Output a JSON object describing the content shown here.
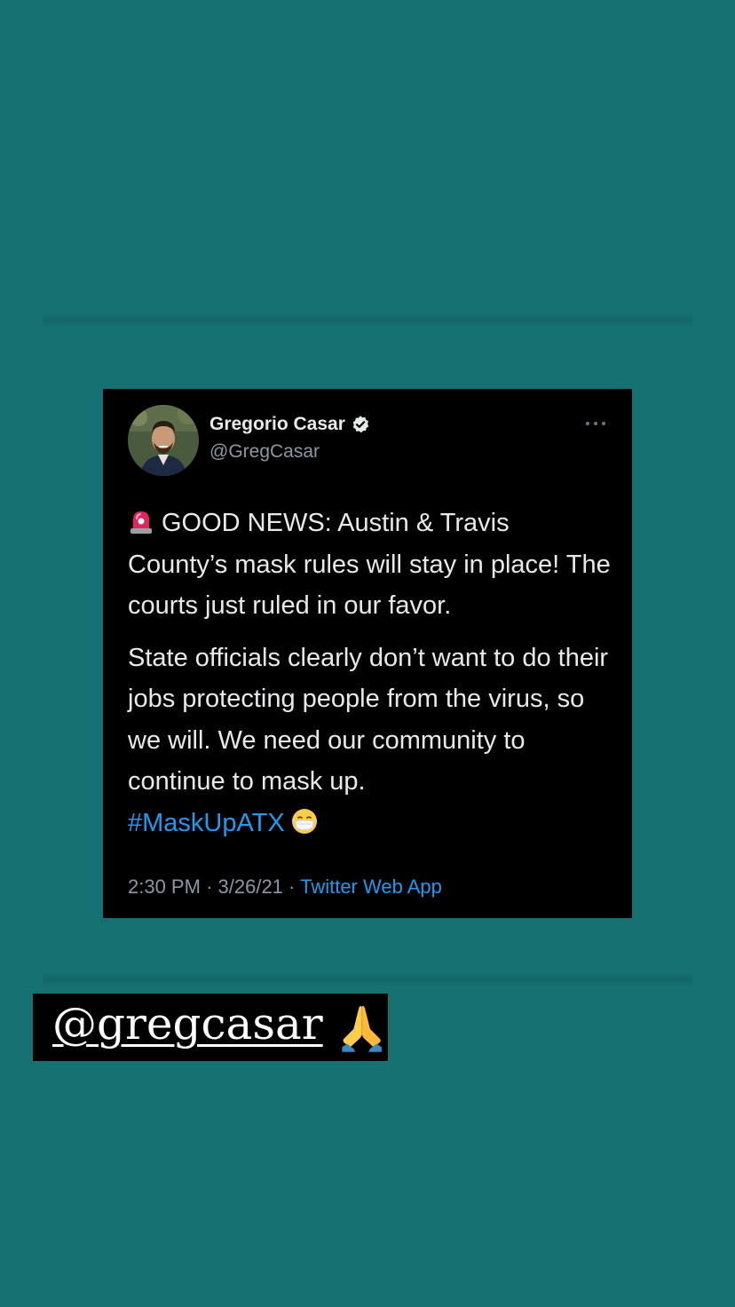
{
  "background_color": "#167272",
  "tweet": {
    "author_name": "Gregorio Casar",
    "author_handle": "@GregCasar",
    "verified_icon": "verified-badge-icon",
    "more_icon": "more-options-icon",
    "avatar_icon": "profile-photo",
    "line_icon": "police-siren-emoji",
    "paragraph1": "GOOD NEWS: Austin & Travis County’s mask rules will stay in place! The courts just ruled in our favor.",
    "paragraph2": "State officials clearly don’t want to do their jobs protecting people from the virus, so we will. We need our community to continue to mask up.",
    "hashtag": "#MaskUpATX",
    "end_emoji": "face-with-medical-mask-emoji",
    "time": "2:30 PM",
    "date": "3/26/21",
    "separator": "·",
    "source": "Twitter Web App",
    "colors": {
      "card_bg": "#000000",
      "text": "#e7e9ea",
      "secondary": "#8b98a5",
      "link": "#1d9bf0"
    }
  },
  "mention_sticker": {
    "text": "@gregcasar",
    "emoji": "folded-hands-emoji",
    "bg": "#000000"
  }
}
